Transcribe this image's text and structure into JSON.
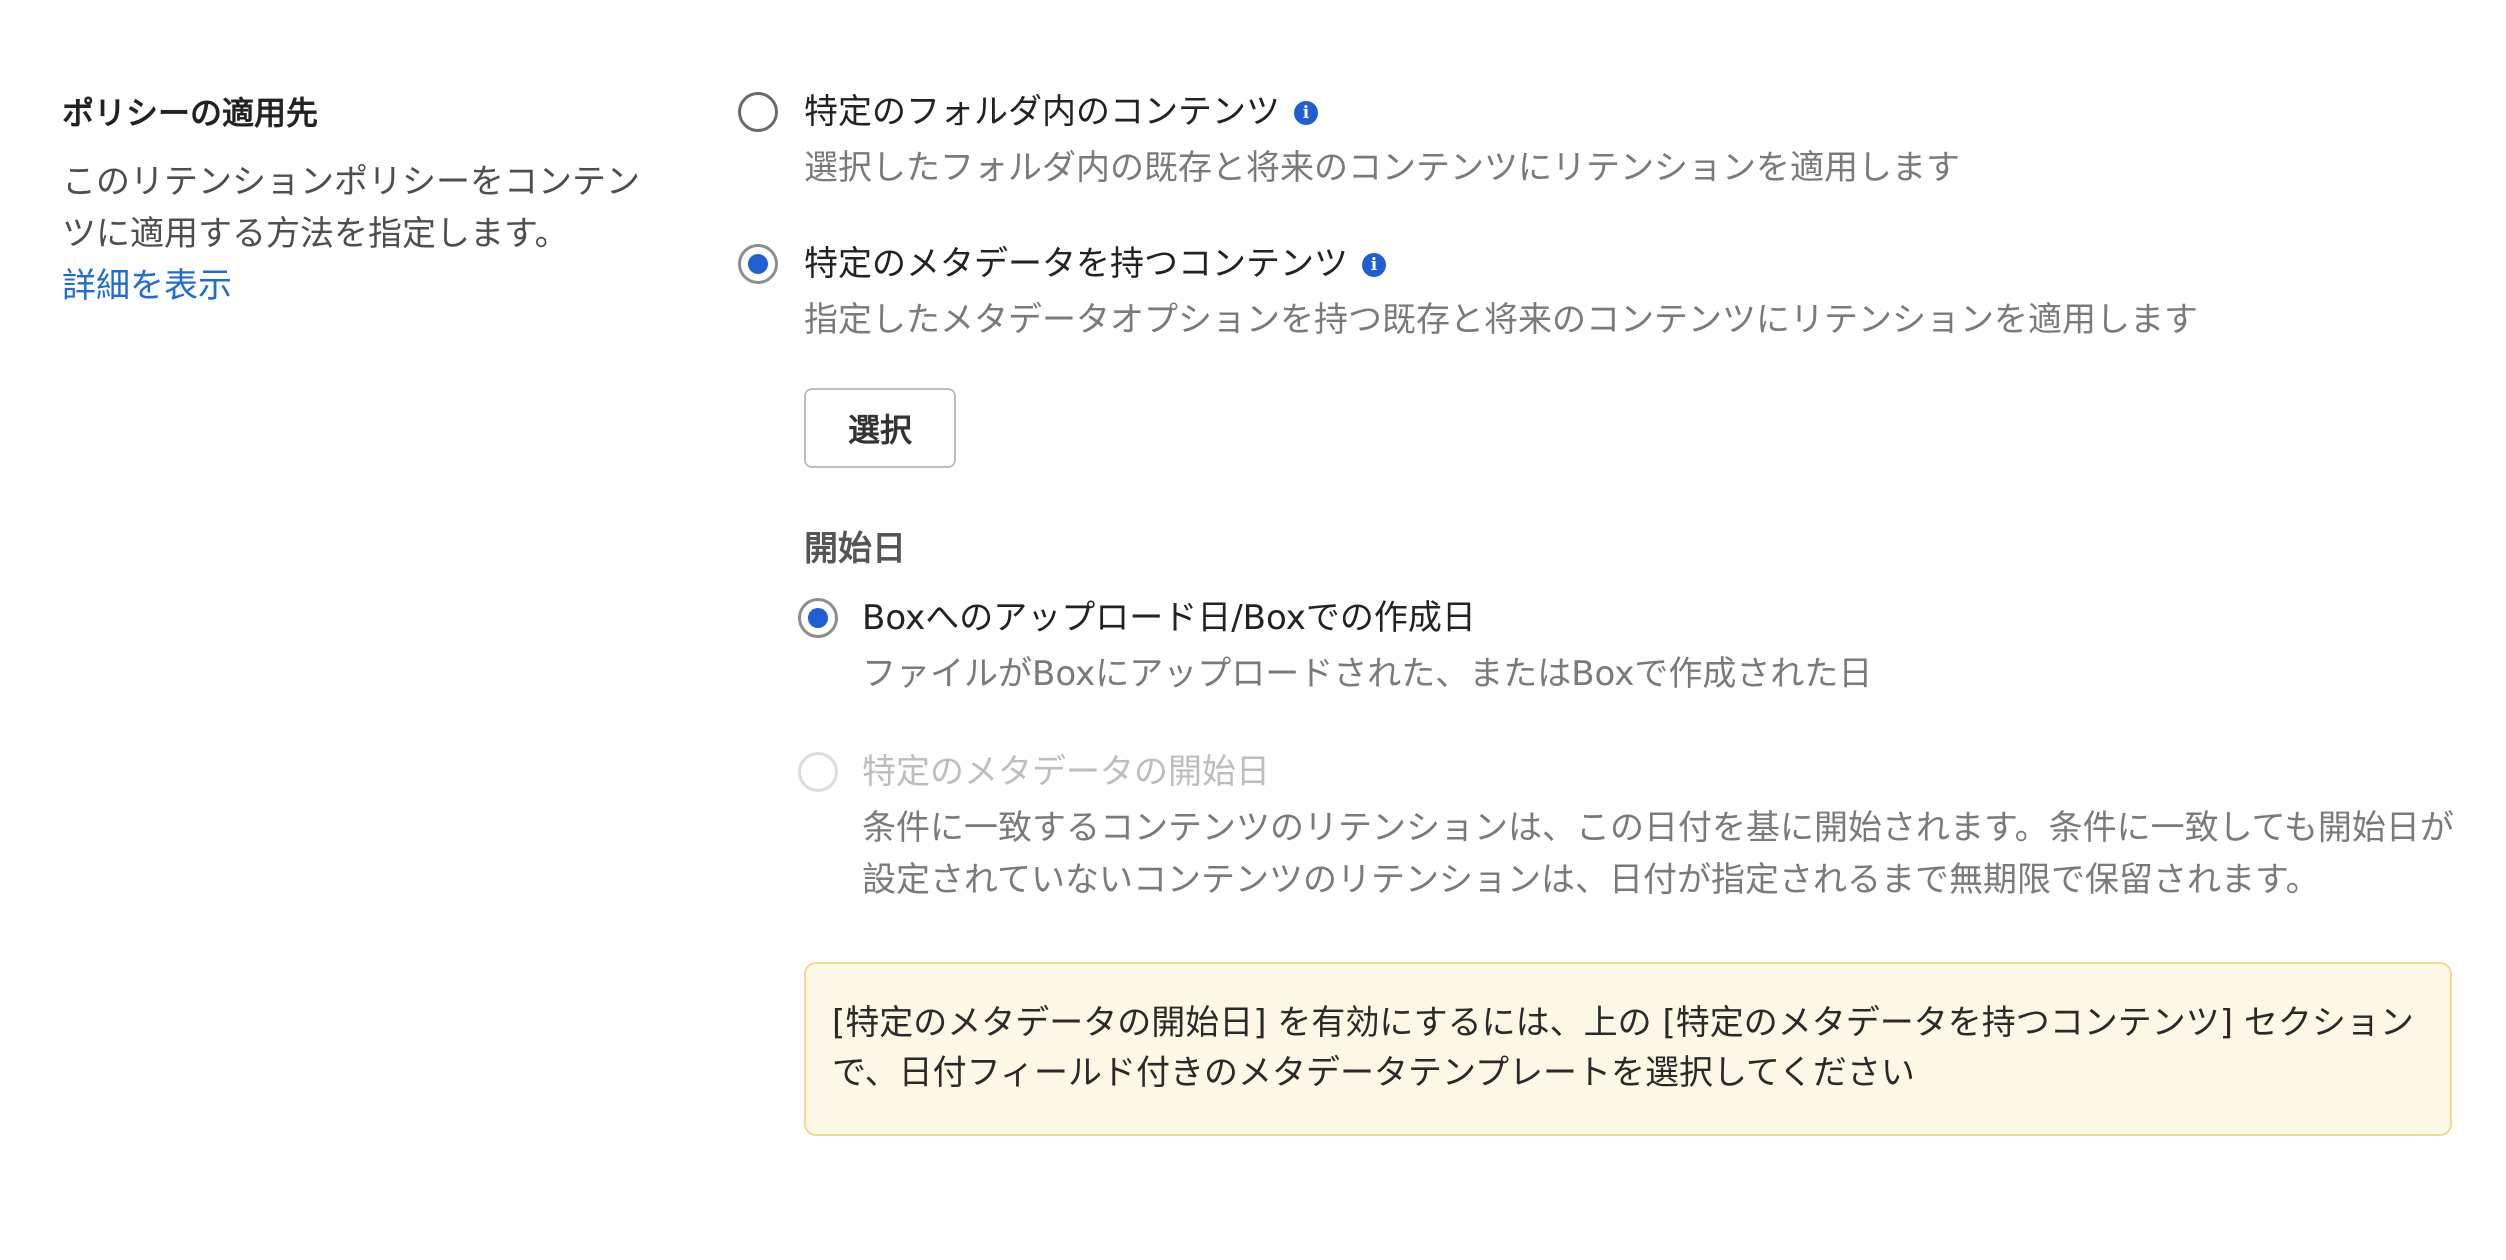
{
  "left": {
    "title": "ポリシーの適用先",
    "description": "このリテンションポリシーをコンテンツに適用する方法を指定します。",
    "link": "詳細を表示"
  },
  "options": [
    {
      "label": "特定のフォルダ内のコンテンツ",
      "description": "選択したフォルダ内の既存と将来のコンテンツにリテンションを適用します",
      "selected": false,
      "info_icon": "info-icon"
    },
    {
      "label": "特定のメタデータを持つコンテンツ",
      "description": "指定したメタデータオプションを持つ既存と将来のコンテンツにリテンションを適用します",
      "selected": true,
      "info_icon": "info-icon"
    }
  ],
  "select_button": "選択",
  "start_date": {
    "heading": "開始日",
    "options": [
      {
        "label": "Boxへのアップロード日/Boxでの作成日",
        "description": "ファイルがBoxにアップロードされた、またはBoxで作成された日",
        "selected": true,
        "disabled": false
      },
      {
        "label": "特定のメタデータの開始日",
        "description": "条件に一致するコンテンツのリテンションは、この日付を基に開始されます。条件に一致しても開始日が設定されていないコンテンツのリテンションは、日付が指定されるまで無期限で保留されます。",
        "selected": false,
        "disabled": true
      }
    ]
  },
  "notice": "[特定のメタデータの開始日] を有効にするには、上の [特定のメタデータを持つコンテンツ] セクションで、日付フィールド付きのメタデータテンプレートを選択してください",
  "colors": {
    "accent": "#1f5fd1",
    "link": "#1f6bd3",
    "notice_bg": "#fdf7e6",
    "notice_border": "#f2d98c"
  }
}
